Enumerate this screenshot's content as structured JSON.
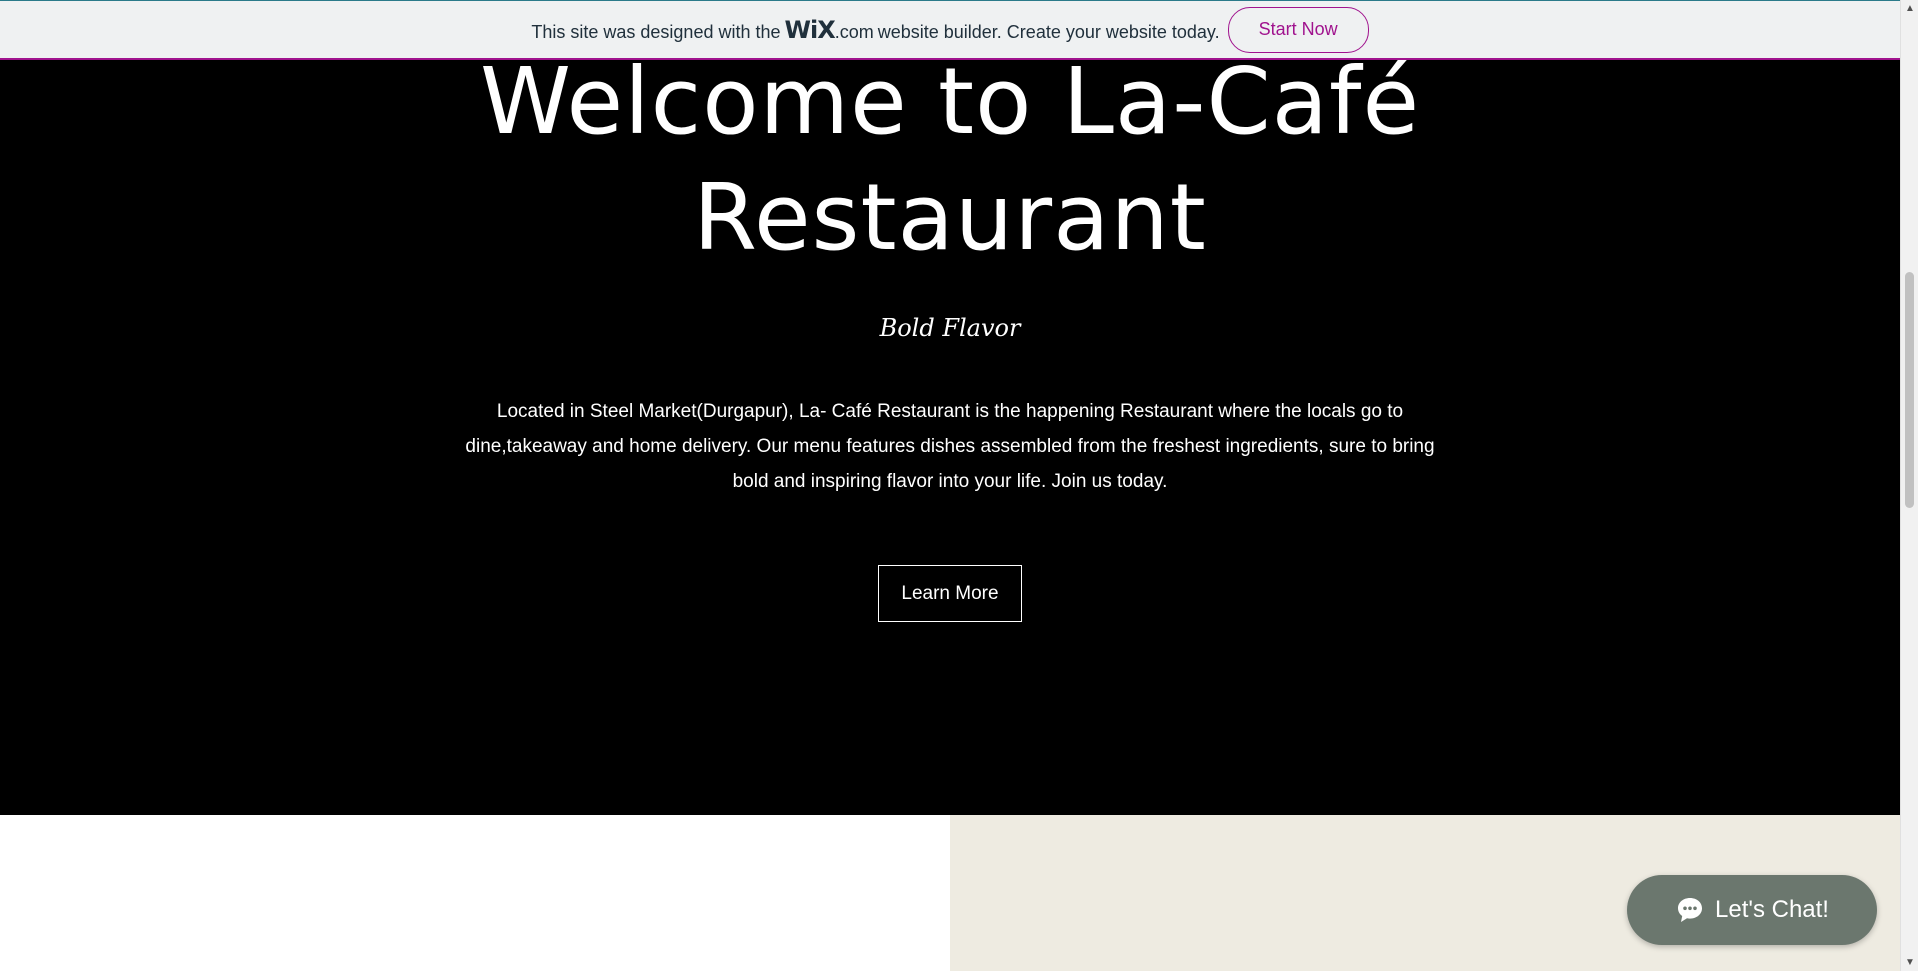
{
  "banner": {
    "text_before": "This site was designed with the",
    "logo": "WiX",
    "logo_suffix": ".com",
    "text_after": "website builder. Create your website today.",
    "cta_label": "Start Now",
    "accent_color": "#a0138e"
  },
  "hero": {
    "title_line1": "Welcome to La-Café",
    "title_line2": "Restaurant",
    "subtitle": "Bold Flavor",
    "description": "Located in Steel Market(Durgapur), La- Café Restaurant is the happening Restaurant where the locals go to dine,takeaway and home delivery. Our menu features dishes assembled from the freshest ingredients, sure to bring bold and inspiring flavor into your life. Join us today.",
    "button_label": "Learn More",
    "background_color": "#000000"
  },
  "sections": {
    "left_color": "#ffffff",
    "right_color": "#eeebe1"
  },
  "chat": {
    "label": "Let's Chat!",
    "icon": "chat-bubble-icon",
    "color": "#6b776e"
  }
}
